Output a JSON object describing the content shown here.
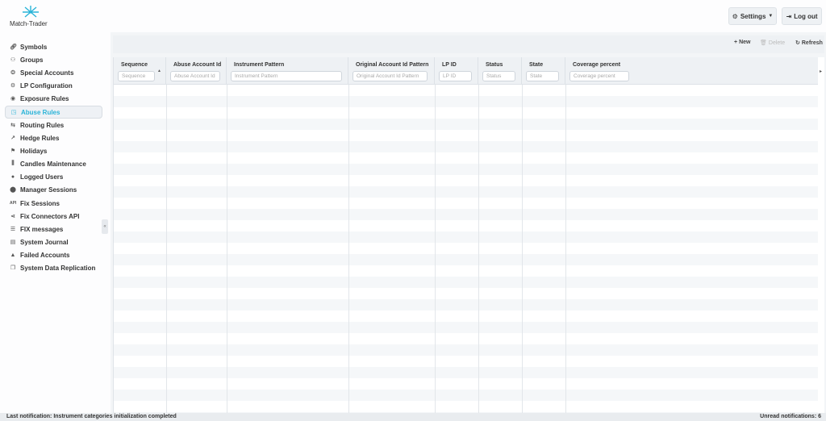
{
  "app": {
    "logo_text": "Match-Trader"
  },
  "header": {
    "settings_label": "Settings",
    "logout_label": "Log out"
  },
  "sidebar": {
    "items": [
      {
        "label": "Symbols",
        "icon": "link-icon"
      },
      {
        "label": "Groups",
        "icon": "groups-icon"
      },
      {
        "label": "Special Accounts",
        "icon": "special-accounts-icon"
      },
      {
        "label": "LP Configuration",
        "icon": "gear-icon"
      },
      {
        "label": "Exposure Rules",
        "icon": "exposure-icon"
      },
      {
        "label": "Abuse Rules",
        "icon": "chart-icon",
        "active": true
      },
      {
        "label": "Routing Rules",
        "icon": "routing-icon"
      },
      {
        "label": "Hedge Rules",
        "icon": "arrow-share-icon"
      },
      {
        "label": "Holidays",
        "icon": "flag-icon"
      },
      {
        "label": "Candles Maintenance",
        "icon": "candles-icon"
      },
      {
        "label": "Logged Users",
        "icon": "user-icon"
      },
      {
        "label": "Manager Sessions",
        "icon": "manager-icon"
      },
      {
        "label": "Fix Sessions",
        "icon": "api-icon"
      },
      {
        "label": "Fix Connectors API",
        "icon": "share-icon"
      },
      {
        "label": "FIX messages",
        "icon": "list-icon"
      },
      {
        "label": "System Journal",
        "icon": "journal-icon"
      },
      {
        "label": "Failed Accounts",
        "icon": "warning-icon"
      },
      {
        "label": "System Data Replication",
        "icon": "replication-icon"
      }
    ]
  },
  "toolbar": {
    "new_label": "New",
    "delete_label": "Delete",
    "refresh_label": "Refresh"
  },
  "table": {
    "columns": [
      {
        "title": "Sequence",
        "placeholder": "Sequence"
      },
      {
        "title": "Abuse Account Id",
        "placeholder": "Abuse Account Id"
      },
      {
        "title": "Instrument Pattern",
        "placeholder": "Instrument Pattern"
      },
      {
        "title": "Original Account Id Pattern",
        "placeholder": "Original Account Id Pattern"
      },
      {
        "title": "LP ID",
        "placeholder": "LP ID"
      },
      {
        "title": "Status",
        "placeholder": "Status"
      },
      {
        "title": "State",
        "placeholder": "State"
      },
      {
        "title": "Coverage percent",
        "placeholder": "Coverage percent"
      }
    ]
  },
  "statusbar": {
    "last_notification": "Last notification: Instrument categories initialization completed",
    "unread": "Unread notifications: 6"
  },
  "colors": {
    "accent": "#2ab4d8",
    "panel": "#eef1f4"
  }
}
